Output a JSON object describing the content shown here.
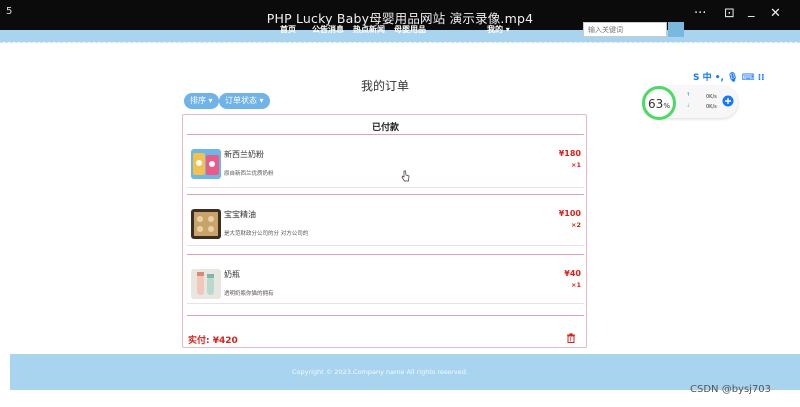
{
  "player": {
    "left_char": "5",
    "title": "PHP Lucky Baby母婴用品网站 演示录像.mp4",
    "controls": [
      "···",
      "⊡",
      "_",
      "✕"
    ]
  },
  "nav": {
    "items": [
      "首页",
      "公告消息",
      "热点新闻",
      "母婴用品"
    ],
    "user_menu": "我的 ▾",
    "search_placeholder": "输入关键词"
  },
  "page": {
    "title": "我的订单",
    "sort_label": "排序 ▾",
    "status_label": "订单状态 ▾"
  },
  "order": {
    "status": "已付款",
    "items": [
      {
        "name": "新西兰奶粉",
        "desc": "原自新西兰优质奶粉",
        "price": "¥180",
        "qty": "×1"
      },
      {
        "name": "宝宝精油",
        "desc": "是大范财政分公司的分 对方公司的",
        "price": "¥100",
        "qty": "×2"
      },
      {
        "name": "奶瓶",
        "desc": "透明奶瓶你猫的拥有",
        "price": "¥40",
        "qty": "×1"
      }
    ],
    "total": "实付: ¥420"
  },
  "footer": {
    "copyright": "Copyright © 2023.Company name All rights reserved."
  },
  "widget": {
    "ime": "S 中 •, 🎙 ⌨ ⁞⁞",
    "percent": "63",
    "percent_unit": "%",
    "up_speed": "0K/s",
    "down_speed": "0K/s"
  },
  "watermark": "CSDN @bysj703",
  "colors": {
    "header_blue": "#a8d4ef",
    "price_red": "#d9211c",
    "pill_blue": "#6fb3e8",
    "card_border": "#e6b9c0"
  }
}
